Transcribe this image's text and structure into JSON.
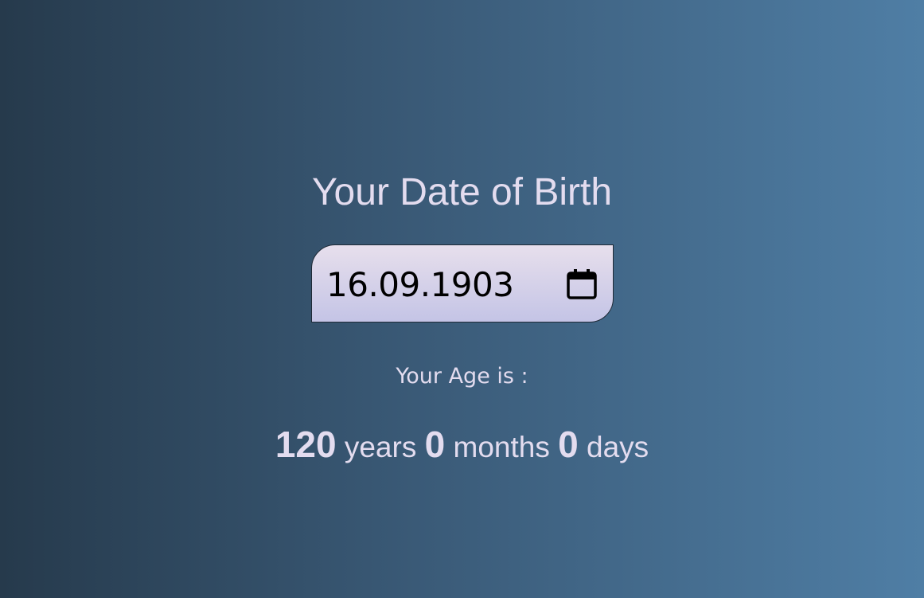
{
  "heading": "Your Date of Birth",
  "date_input": {
    "value": "16.09.1903",
    "icon": "calendar-icon"
  },
  "age_label": "Your Age is :",
  "age": {
    "years": "120",
    "years_unit": "years",
    "months": "0",
    "months_unit": "months",
    "days": "0",
    "days_unit": "days"
  },
  "colors": {
    "background_left": "#263a4c",
    "background_right": "#4f7ea5",
    "text": "#e3dcef",
    "input_top": "#e7dfec",
    "input_bottom": "#c4c4e6"
  }
}
